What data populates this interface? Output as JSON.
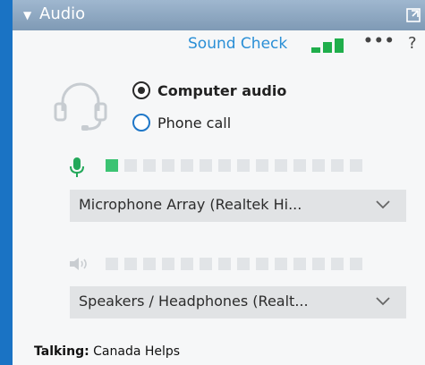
{
  "window": {
    "title": "Audio",
    "collapse_glyph": "▼",
    "popout_icon": "popout-icon"
  },
  "toolbar": {
    "sound_check": "Sound Check",
    "more": "•••",
    "help": "?",
    "signal_icon": "signal-bars-icon",
    "signal_color": "#1fae4b"
  },
  "connection": {
    "headset_icon": "headset-icon",
    "options": [
      {
        "label": "Computer audio",
        "selected": true
      },
      {
        "label": "Phone call",
        "selected": false
      }
    ]
  },
  "microphone": {
    "icon": "microphone-icon",
    "level_segments": 14,
    "level_active": 1,
    "device": "Microphone Array (Realtek Hi..."
  },
  "speaker": {
    "icon": "speaker-icon",
    "level_segments": 14,
    "level_active": 0,
    "device": "Speakers / Headphones (Realt..."
  },
  "status": {
    "label": "Talking:",
    "name": "Canada Helps"
  },
  "colors": {
    "accent": "#2a8fd6",
    "meter_on": "#3cc373",
    "meter_off": "#e1e4e7",
    "background": "#1a73c4"
  }
}
